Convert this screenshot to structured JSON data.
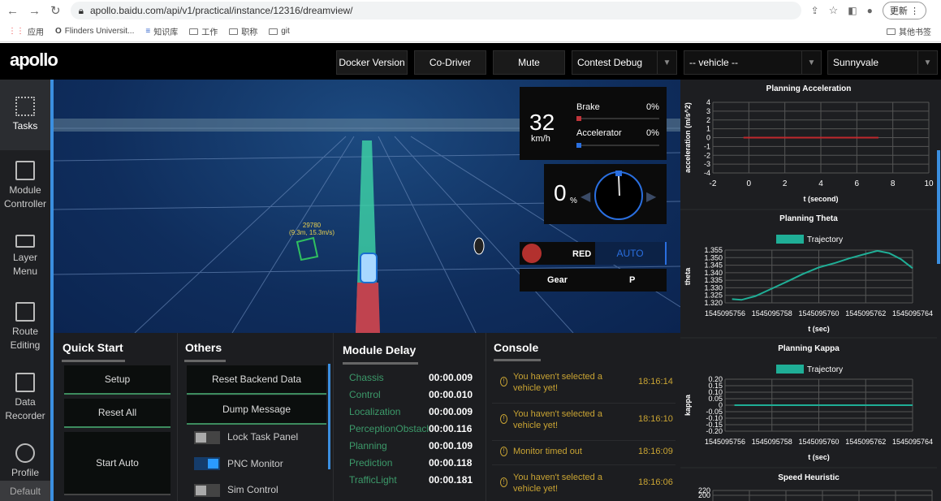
{
  "browser": {
    "url": "apollo.baidu.com/api/v1/practical/instance/12316/dreamview/",
    "update_label": "更新",
    "bookmarks": [
      "应用",
      "Flinders Universit...",
      "知识库",
      "工作",
      "职称",
      "git"
    ],
    "other_bookmarks": "其他书签"
  },
  "header": {
    "logo": "apollo",
    "buttons": [
      "Docker Version",
      "Co-Driver",
      "Mute"
    ],
    "mode_select": "Contest Debug",
    "vehicle_select": "-- vehicle --",
    "map_select": "Sunnyvale"
  },
  "sidebar": {
    "items": [
      {
        "label": "Tasks"
      },
      {
        "label": "Module Controller"
      },
      {
        "label": "Layer Menu"
      },
      {
        "label": "Route Editing"
      },
      {
        "label": "Data Recorder"
      },
      {
        "label": "Profile"
      }
    ],
    "default_label": "Default"
  },
  "scene": {
    "obstacle_id": "29780",
    "obstacle_info": "(9.3m, 15.3m/s)"
  },
  "dashboard": {
    "speed": "32",
    "speed_unit": "km/h",
    "brake_label": "Brake",
    "brake_value": "0%",
    "accel_label": "Accelerator",
    "accel_value": "0%",
    "steering": "0",
    "steering_unit": "%",
    "signal": "RED",
    "drive_mode": "AUTO",
    "gear_label": "Gear",
    "gear_value": "P"
  },
  "quick_start": {
    "title": "Quick Start",
    "buttons": [
      "Setup",
      "Reset All",
      "Start Auto"
    ]
  },
  "others": {
    "title": "Others",
    "buttons": [
      "Reset Backend Data",
      "Dump Message"
    ],
    "toggles": [
      {
        "label": "Lock Task Panel",
        "on": false
      },
      {
        "label": "PNC Monitor",
        "on": true
      },
      {
        "label": "Sim Control",
        "on": false
      }
    ]
  },
  "module_delay": {
    "title": "Module Delay",
    "rows": [
      {
        "name": "Chassis",
        "value": "00:00.009"
      },
      {
        "name": "Control",
        "value": "00:00.010"
      },
      {
        "name": "Localization",
        "value": "00:00.009"
      },
      {
        "name": "PerceptionObstacle",
        "value": "00:00.116"
      },
      {
        "name": "Planning",
        "value": "00:00.109"
      },
      {
        "name": "Prediction",
        "value": "00:00.118"
      },
      {
        "name": "TrafficLight",
        "value": "00:00.181"
      }
    ]
  },
  "console": {
    "title": "Console",
    "messages": [
      {
        "text": "You haven't selected a vehicle yet!",
        "time": "18:16:14"
      },
      {
        "text": "You haven't selected a vehicle yet!",
        "time": "18:16:10"
      },
      {
        "text": "Monitor timed out",
        "time": "18:16:09"
      },
      {
        "text": "You haven't selected a vehicle yet!",
        "time": "18:16:06"
      }
    ]
  },
  "chart_data": [
    {
      "type": "line",
      "title": "Planning Acceleration",
      "xlabel": "t (second)",
      "ylabel": "acceleration (m/s^2)",
      "xlim": [
        -2,
        10
      ],
      "ylim": [
        -4,
        4
      ],
      "xticks": [
        "-2",
        "0",
        "2",
        "4",
        "6",
        "8",
        "10"
      ],
      "yticks": [
        "4",
        "3",
        "2",
        "1",
        "0",
        "-1",
        "-2",
        "-3",
        "-4"
      ],
      "grid": true,
      "series": [
        {
          "name": "acceleration",
          "color": "#c0282d",
          "x": [
            -0.3,
            7.2
          ],
          "y": [
            0,
            0
          ]
        }
      ]
    },
    {
      "type": "line",
      "title": "Planning Theta",
      "xlabel": "t (sec)",
      "ylabel": "theta",
      "legend": "top",
      "xlim": [
        1545095756,
        1545095764
      ],
      "ylim": [
        1.32,
        1.355
      ],
      "xticks": [
        "1545095756",
        "1545095758",
        "1545095760",
        "1545095762",
        "1545095764"
      ],
      "yticks": [
        "1.355",
        "1.350",
        "1.345",
        "1.340",
        "1.335",
        "1.330",
        "1.325",
        "1.320"
      ],
      "grid": true,
      "series": [
        {
          "name": "Trajectory",
          "color": "#1fae96",
          "x": [
            1545095756.3,
            1545095756.7,
            1545095757.3,
            1545095758,
            1545095758.7,
            1545095759.3,
            1545095760,
            1545095760.7,
            1545095761.3,
            1545095762,
            1545095762.5,
            1545095763,
            1545095763.5,
            1545095764
          ],
          "y": [
            1.3225,
            1.322,
            1.3245,
            1.3295,
            1.3345,
            1.339,
            1.3435,
            1.3465,
            1.3495,
            1.3525,
            1.3545,
            1.353,
            1.349,
            1.343
          ]
        }
      ]
    },
    {
      "type": "line",
      "title": "Planning Kappa",
      "xlabel": "t (sec)",
      "ylabel": "kappa",
      "legend": "top",
      "xlim": [
        1545095756,
        1545095764
      ],
      "ylim": [
        -0.2,
        0.2
      ],
      "xticks": [
        "1545095756",
        "1545095758",
        "1545095760",
        "1545095762",
        "1545095764"
      ],
      "yticks": [
        "0.20",
        "0.15",
        "0.10",
        "0.05",
        "0",
        "-0.05",
        "-0.10",
        "-0.15",
        "-0.20"
      ],
      "grid": true,
      "series": [
        {
          "name": "Trajectory",
          "color": "#1fae96",
          "x": [
            1545095756.4,
            1545095764
          ],
          "y": [
            0,
            0
          ]
        }
      ]
    },
    {
      "type": "line",
      "title": "Speed Heuristic",
      "yticks": [
        "220",
        "200"
      ]
    }
  ]
}
